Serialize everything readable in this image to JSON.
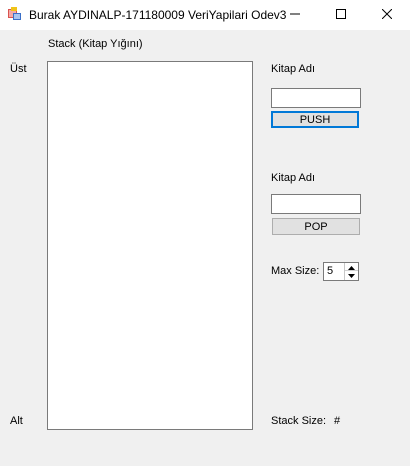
{
  "window": {
    "title": "Burak AYDINALP-171180009 VeriYapilari Odev3"
  },
  "stack": {
    "header": "Stack (Kitap Yığını)",
    "top_label": "Üst",
    "bottom_label": "Alt",
    "items": []
  },
  "push_panel": {
    "label": "Kitap Adı",
    "input_value": "",
    "button_label": "PUSH"
  },
  "pop_panel": {
    "label": "Kitap Adı",
    "input_value": "",
    "button_label": "POP"
  },
  "max_size": {
    "label": "Max Size:",
    "value": "5"
  },
  "stack_size": {
    "label": "Stack Size:",
    "value": "#"
  },
  "colors": {
    "focus_border": "#0078d7",
    "window_bg": "#f0f0f0"
  }
}
